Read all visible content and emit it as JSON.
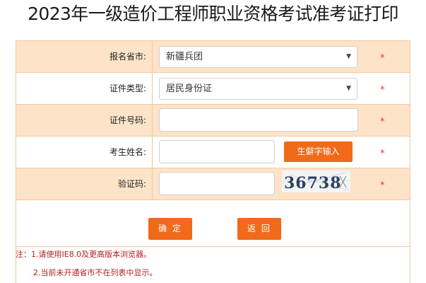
{
  "page": {
    "title": "2023年一级造价工程师职业资格考试准考证打印"
  },
  "form": {
    "province": {
      "label": "报名省市:",
      "selected": "新疆兵团"
    },
    "id_type": {
      "label": "证件类型:",
      "selected": "居民身份证"
    },
    "id_number": {
      "label": "证件号码:",
      "value": "",
      "placeholder": ""
    },
    "name": {
      "label": "考生姓名:",
      "value": "",
      "placeholder": "",
      "rare_char_button": "生僻字输入"
    },
    "captcha": {
      "label": "验证码:",
      "value": "",
      "placeholder": "",
      "image_text": "36738"
    },
    "required_mark": "*"
  },
  "actions": {
    "confirm_label": "确 定",
    "back_label": "返 回"
  },
  "notes": {
    "line1": "注：1.请使用IE8.0及更高版本浏览器。",
    "line2": "2.当前未开通省市不在列表中显示。"
  },
  "colors": {
    "accent": "#f06a1a",
    "row_peach": "#fde4c8",
    "border": "#f0c9a0",
    "required": "#e4392b",
    "note_text": "#b32020"
  }
}
